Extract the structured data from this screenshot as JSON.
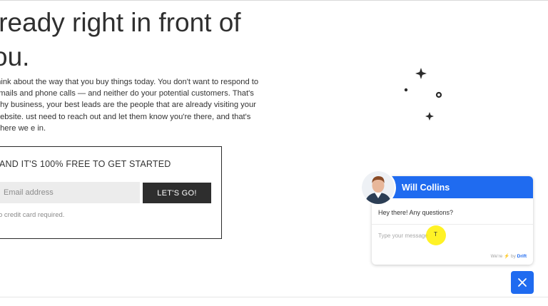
{
  "hero": {
    "headline": "lready right in front of\nou.",
    "paragraph": "think about the way that you buy things today. You don't want to respond to emails and phone calls — and neither do your potential customers. That's why business, your best leads are the people that are already visiting your website. ust need to reach out and let them know you're there, and that's where we e in."
  },
  "signup": {
    "title": "AND IT'S 100% FREE TO GET STARTED",
    "email_placeholder": "Email address",
    "button_label": "LET'S GO!",
    "fine_print": "o credit card required."
  },
  "chat": {
    "agent_name": "Will Collins",
    "message": "Hey there! Any questions?",
    "input_placeholder": "Type your message",
    "powered_prefix": "We're",
    "powered_bolt": "⚡",
    "powered_by": "by",
    "brand": "Drift",
    "close_icon": "close-icon",
    "accent_color": "#1f6bf0"
  },
  "cursor": {
    "caret": "T"
  }
}
